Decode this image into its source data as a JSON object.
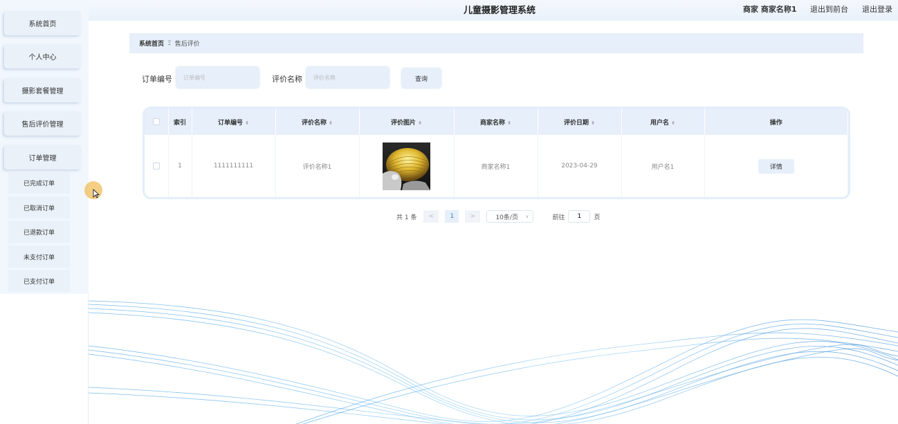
{
  "header": {
    "title": "儿童摄影管理系统",
    "user_info": "商家 商家名称1",
    "front_link": "退出到前台",
    "logout_link": "退出登录"
  },
  "sidebar": {
    "items": [
      {
        "label": "系统首页"
      },
      {
        "label": "个人中心"
      },
      {
        "label": "摄影套餐管理"
      },
      {
        "label": "售后评价管理"
      },
      {
        "label": "订单管理"
      }
    ],
    "subitems": [
      {
        "label": "已完成订单"
      },
      {
        "label": "已取消订单"
      },
      {
        "label": "已退款订单"
      },
      {
        "label": "未支付订单"
      },
      {
        "label": "已支付订单"
      }
    ]
  },
  "breadcrumb": {
    "home": "系统首页",
    "separator": "Ξ",
    "current": "售后评价"
  },
  "search": {
    "order_label": "订单编号",
    "order_placeholder": "订单编号",
    "review_label": "评价名称",
    "review_placeholder": "评价名称",
    "query_button": "查询"
  },
  "table": {
    "headers": [
      "索引",
      "订单编号",
      "评价名称",
      "评价图片",
      "商家名称",
      "评价日期",
      "用户名",
      "操作"
    ],
    "rows": [
      {
        "index": "1",
        "order_no": "1111111111",
        "review_name": "评价名称1",
        "merchant": "商家名称1",
        "date": "2023-04-29",
        "username": "用户名1",
        "action": "详情"
      }
    ]
  },
  "pagination": {
    "total": "共 1 条",
    "prev": "<",
    "current_page": "1",
    "next": ">",
    "page_size": "10条/页",
    "goto_prefix": "前往",
    "goto_value": "1",
    "goto_suffix": "页"
  },
  "colors": {
    "accent": "#3a7bd5",
    "panel": "#e6effa"
  }
}
